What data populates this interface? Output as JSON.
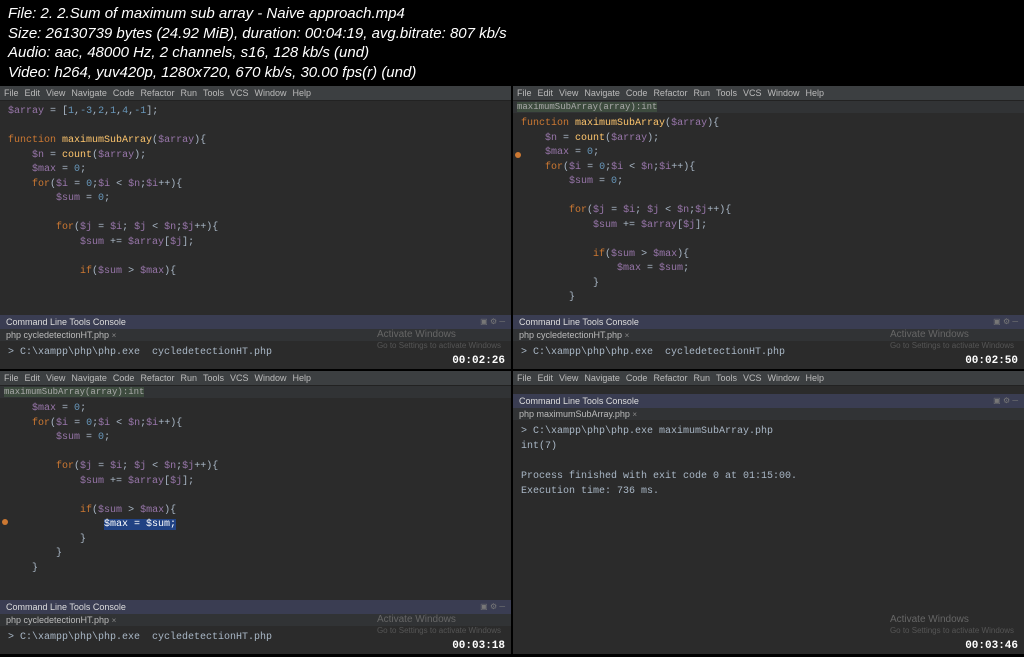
{
  "header": {
    "line1": "File: 2. 2.Sum of maximum sub array - Naive approach.mp4",
    "line2": "Size: 26130739 bytes (24.92 MiB), duration: 00:04:19, avg.bitrate: 807 kb/s",
    "line3": "Audio: aac, 48000 Hz, 2 channels, s16, 128 kb/s (und)",
    "line4": "Video: h264, yuv420p, 1280x720, 670 kb/s, 30.00 fps(r) (und)"
  },
  "menu": [
    "File",
    "Edit",
    "View",
    "Navigate",
    "Code",
    "Refactor",
    "Run",
    "Tools",
    "VCS",
    "Window",
    "Help"
  ],
  "breadcrumb_sig": "maximumSubArray(array):int",
  "console_title": "Command Line Tools Console",
  "watermark": {
    "title": "Activate Windows",
    "sub": "Go to Settings to activate Windows"
  },
  "panes": [
    {
      "timestamp": "00:02:26",
      "tab": "php cycledetectionHT.php",
      "cmd": "> C:\\xampp\\php\\php.exe  cycledetectionHT.php",
      "code": {
        "l1": "$array = [1,-3,2,1,4,-1];",
        "l2": "function maximumSubArray($array){",
        "l3": "    $n = count($array);",
        "l4": "    $max = 0;",
        "l5": "    for($i = 0;$i < $n;$i++){",
        "l6": "        $sum = 0;",
        "l7": "        for($j = $i; $j < $n;$j++){",
        "l8": "            $sum += $array[$j];",
        "l9": "            if($sum > $max){"
      }
    },
    {
      "timestamp": "00:02:50",
      "tab": "php cycledetectionHT.php",
      "cmd": "> C:\\xampp\\php\\php.exe  cycledetectionHT.php",
      "code": {
        "l1": "function maximumSubArray($array){",
        "l2": "    $n = count($array);",
        "l3": "    $max = 0;",
        "l4": "    for($i = 0;$i < $n;$i++){",
        "l5": "        $sum = 0;",
        "l6": "        for($j = $i; $j < $n;$j++){",
        "l7": "            $sum += $array[$j];",
        "l8": "            if($sum > $max){",
        "l9": "                $max = $sum;",
        "l10": "            }",
        "l11": "        }"
      }
    },
    {
      "timestamp": "00:03:18",
      "tab": "php cycledetectionHT.php",
      "cmd": "> C:\\xampp\\php\\php.exe  cycledetectionHT.php",
      "code": {
        "l1": "    $max = 0;",
        "l2": "    for($i = 0;$i < $n;$i++){",
        "l3": "        $sum = 0;",
        "l4": "        for($j = $i; $j < $n;$j++){",
        "l5": "            $sum += $array[$j];",
        "l6": "            if($sum > $max){",
        "l7": "                $max = $sum;",
        "l8": "            }",
        "l9": "        }",
        "l10": "    }"
      }
    },
    {
      "timestamp": "00:03:46",
      "tab": "php maximumSubArray.php",
      "output": {
        "l1": "> C:\\xampp\\php\\php.exe maximumSubArray.php",
        "l2": "int(7)",
        "l3": "",
        "l4": "Process finished with exit code 0 at 01:15:00.",
        "l5": "Execution time: 736 ms."
      }
    }
  ]
}
